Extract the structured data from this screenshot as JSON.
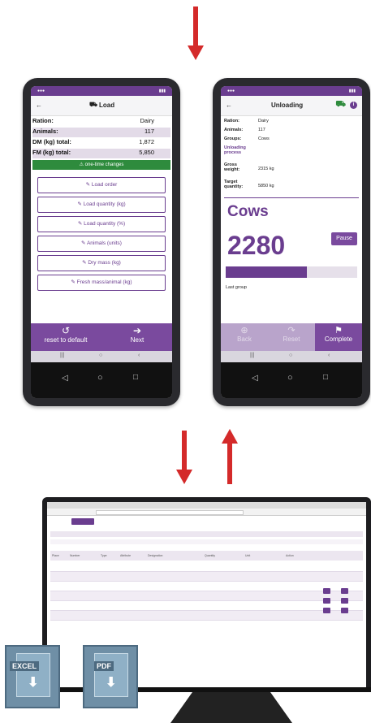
{
  "load_screen": {
    "title": "Load",
    "rows": [
      {
        "label": "Ration:",
        "value": "Dairy"
      },
      {
        "label": "Animals:",
        "value": "117"
      },
      {
        "label": "DM (kg) total:",
        "value": "1,872"
      },
      {
        "label": "FM (kg) total:",
        "value": "5,850"
      }
    ],
    "alert": "one-time changes",
    "buttons": [
      "Load order",
      "Load quantity (kg)",
      "Load quantity (%)",
      "Animals (units)",
      "Dry mass (kg)",
      "Fresh mass/animal (kg)"
    ],
    "reset_label": "reset to default",
    "next_label": "Next"
  },
  "unloading_screen": {
    "title": "Unloading",
    "rows": [
      {
        "label": "Ration:",
        "value": "Dairy"
      },
      {
        "label": "Animals:",
        "value": "117"
      },
      {
        "label": "Groups:",
        "value": "Cows"
      },
      {
        "label": "Unloading process",
        "value": ""
      },
      {
        "label": "Gross weight:",
        "value": "2315 kg"
      },
      {
        "label": "Target quantity:",
        "value": "5850 kg"
      }
    ],
    "group_name": "Cows",
    "counter": "2280",
    "pause_label": "Pause",
    "progress": 0.62,
    "last_group_label": "Last group",
    "back_label": "Back",
    "reset_label": "Reset",
    "complete_label": "Complete"
  },
  "desktop": {
    "table_headers": [
      "Place",
      "Number",
      "Type",
      "Attribute",
      "Designation",
      "Quantity",
      "Unit",
      "Action"
    ],
    "excel_label": "EXCEL",
    "pdf_label": "PDF"
  },
  "colors": {
    "accent": "#6a3d8f",
    "arrow": "#d42a2a",
    "alert": "#2e8b3d"
  }
}
